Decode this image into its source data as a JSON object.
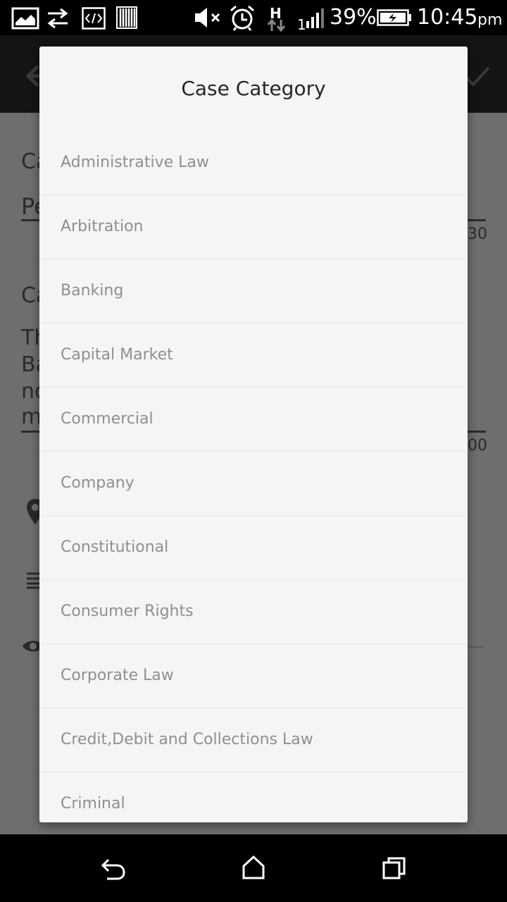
{
  "status_bar": {
    "signal_label": "1",
    "battery_percent": "39%",
    "time": "10:45",
    "ampm": "pm",
    "network_type": "H"
  },
  "background": {
    "field1_label": "Ca",
    "field1_value": "Pe",
    "field1_counter": "30",
    "field2_label": "Ca",
    "field2_line1": "Th",
    "field2_line2": "Ba",
    "field2_line3": "no",
    "field2_line4": "m",
    "field2_counter": "00"
  },
  "dialog": {
    "title": "Case Category",
    "options": [
      "Administrative Law",
      "Arbitration",
      "Banking",
      "Capital Market",
      "Commercial",
      "Company",
      "Constitutional",
      "Consumer Rights",
      "Corporate Law",
      "Credit,Debit and Collections Law",
      "Criminal"
    ]
  },
  "icons": {
    "status": [
      "image-icon",
      "sync-arrows-icon",
      "code-icon",
      "barcode-icon",
      "mute-icon",
      "alarm-icon",
      "data-arrows-icon",
      "signal-icon",
      "battery-charging-icon"
    ],
    "nav": [
      "back-icon",
      "home-icon",
      "recent-apps-icon"
    ]
  },
  "colors": {
    "dialog_bg": "#f5f5f5",
    "title_text": "#262626",
    "option_text": "#8f8f8f",
    "app_bar": "#121416",
    "scrim": "#6e6e6e"
  }
}
